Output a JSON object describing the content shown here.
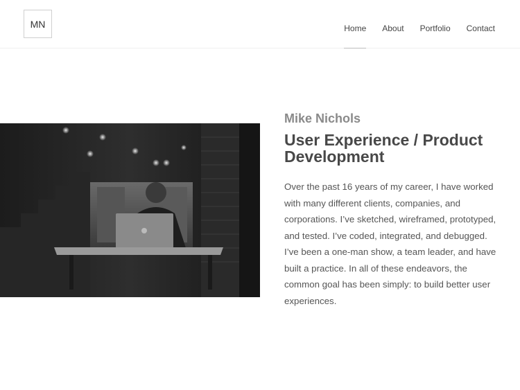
{
  "header": {
    "logo_text": "MN",
    "nav": [
      {
        "label": "Home",
        "active": true
      },
      {
        "label": "About",
        "active": false
      },
      {
        "label": "Portfolio",
        "active": false
      },
      {
        "label": "Contact",
        "active": false
      }
    ]
  },
  "hero": {
    "photo_icon": "man-with-laptop-photo",
    "name": "Mike Nichols",
    "title": "User Experience / Product Development",
    "bio": "Over the past 16 years of my career, I have worked with many different clients, companies, and corporations. I’ve sketched, wireframed, prototyped, and tested. I’ve coded, integrated, and debugged. I’ve been a one-man show, a team leader, and have built a practice. In all of these endeavors, the common goal has been simply: to build better user experiences."
  }
}
